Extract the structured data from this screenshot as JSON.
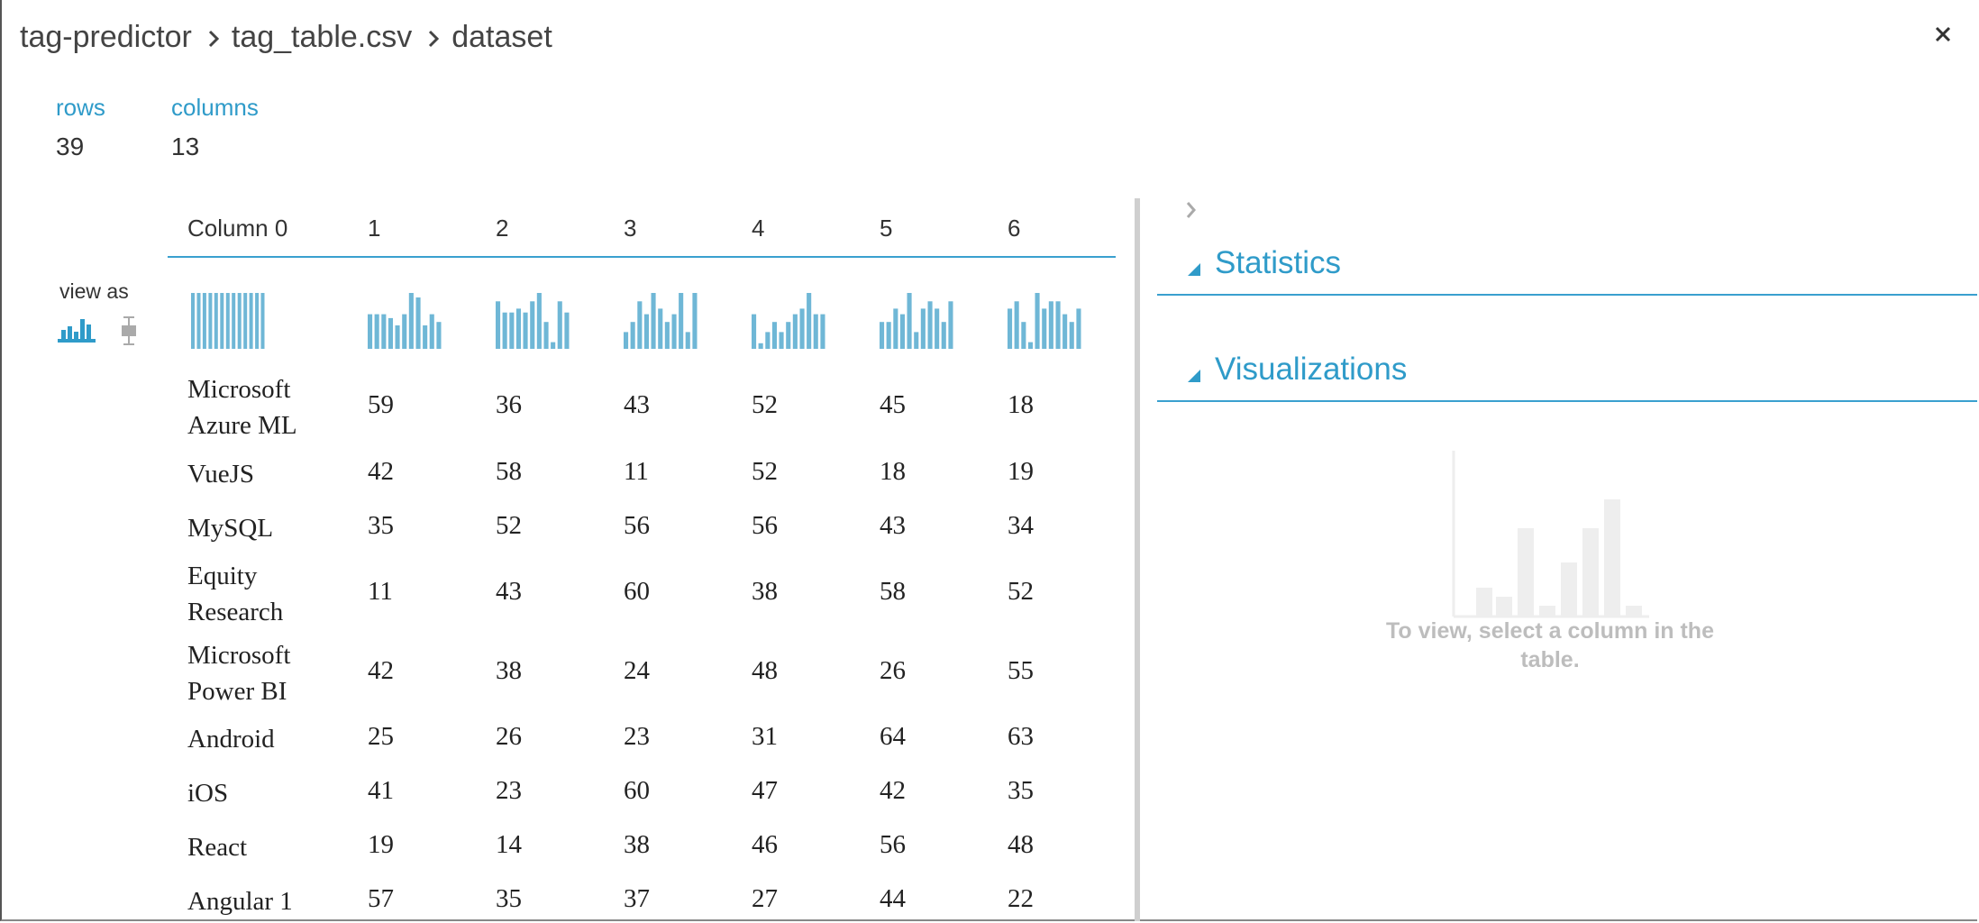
{
  "breadcrumb": [
    "tag-predictor",
    "tag_table.csv",
    "dataset"
  ],
  "summary": {
    "rows_label": "rows",
    "rows_value": "39",
    "columns_label": "columns",
    "columns_value": "13"
  },
  "view_as": {
    "label": "view as",
    "icons": [
      "histogram-icon",
      "boxplot-icon"
    ]
  },
  "table": {
    "headers": [
      "Column 0",
      "1",
      "2",
      "3",
      "4",
      "5",
      "6"
    ],
    "rows": [
      {
        "label": "Microsoft Azure ML",
        "values": [
          "59",
          "36",
          "43",
          "52",
          "45",
          "18"
        ]
      },
      {
        "label": "VueJS",
        "values": [
          "42",
          "58",
          "11",
          "52",
          "18",
          "19"
        ]
      },
      {
        "label": "MySQL",
        "values": [
          "35",
          "52",
          "56",
          "56",
          "43",
          "34"
        ]
      },
      {
        "label": "Equity Research",
        "values": [
          "11",
          "43",
          "60",
          "38",
          "58",
          "52"
        ]
      },
      {
        "label": "Microsoft Power BI",
        "values": [
          "42",
          "38",
          "24",
          "48",
          "26",
          "55"
        ]
      },
      {
        "label": "Android",
        "values": [
          "25",
          "26",
          "23",
          "31",
          "64",
          "63"
        ]
      },
      {
        "label": "iOS",
        "values": [
          "41",
          "23",
          "60",
          "47",
          "42",
          "35"
        ]
      },
      {
        "label": "React",
        "values": [
          "19",
          "14",
          "38",
          "46",
          "56",
          "48"
        ]
      },
      {
        "label": "Angular 1",
        "values": [
          "57",
          "35",
          "37",
          "27",
          "44",
          "22"
        ]
      }
    ],
    "sparklines": [
      [
        1,
        1,
        1,
        1,
        1,
        1,
        1,
        1,
        1,
        1,
        1,
        1,
        1
      ],
      [
        0.62,
        0.62,
        0.62,
        0.55,
        0.42,
        0.62,
        1,
        0.92,
        0.42,
        0.62,
        0.48
      ],
      [
        0.85,
        0.65,
        0.65,
        0.72,
        0.65,
        0.85,
        1,
        0.48,
        0.12,
        0.85,
        0.65
      ],
      [
        0.3,
        0.48,
        0.85,
        0.62,
        1,
        0.72,
        0.48,
        0.62,
        1,
        0.3,
        1
      ],
      [
        0.62,
        0.1,
        0.3,
        0.48,
        0.3,
        0.48,
        0.62,
        0.72,
        1,
        0.62,
        0.62
      ],
      [
        0.48,
        0.48,
        0.72,
        0.62,
        1,
        0.3,
        0.72,
        0.85,
        0.72,
        0.48,
        0.85
      ],
      [
        0.72,
        0.85,
        0.48,
        0.12,
        1,
        0.72,
        0.85,
        0.85,
        0.62,
        0.48,
        0.72
      ]
    ]
  },
  "right_panel": {
    "sections": [
      "Statistics",
      "Visualizations"
    ],
    "placeholder": "To view, select a column in the table."
  },
  "colors": {
    "accent": "#2f9bc9",
    "bar": "#6fb7d6",
    "muted": "#bdbdbd"
  }
}
